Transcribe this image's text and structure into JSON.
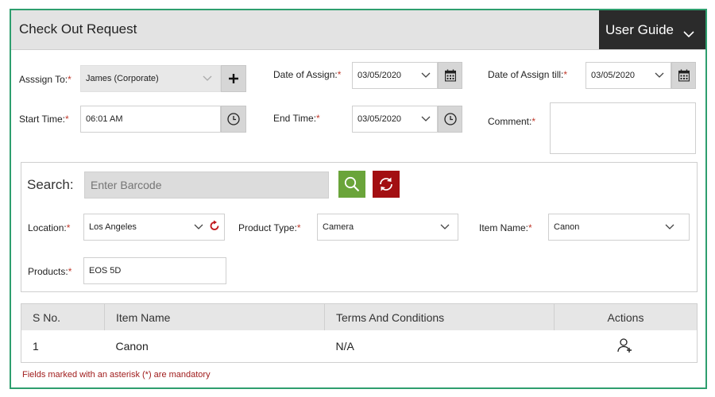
{
  "header": {
    "title": "Check Out Request",
    "user_guide_label": "User Guide"
  },
  "form": {
    "assign_to": {
      "label": "Asssign To:",
      "required_mark": "*",
      "value": "James (Corporate)"
    },
    "date_of_assign": {
      "label": "Date of Assign:",
      "required_mark": "*",
      "value": "03/05/2020"
    },
    "date_of_assign_till": {
      "label": "Date of Assign till:",
      "required_mark": "*",
      "value": "03/05/2020"
    },
    "start_time": {
      "label": "Start Time:",
      "required_mark": "*",
      "value": "06:01 AM"
    },
    "end_time": {
      "label": "End Time:",
      "required_mark": "*",
      "value": "03/05/2020"
    },
    "comment": {
      "label": "Comment:",
      "required_mark": "*",
      "value": ""
    }
  },
  "search": {
    "label": "Search:",
    "barcode_placeholder": "Enter Barcode",
    "location": {
      "label": "Location:",
      "required_mark": "*",
      "value": "Los Angeles"
    },
    "product_type": {
      "label": "Product Type:",
      "required_mark": "*",
      "value": "Camera"
    },
    "item_name": {
      "label": "Item Name:",
      "required_mark": "*",
      "value": "Canon"
    },
    "products": {
      "label": "Products:",
      "required_mark": "*",
      "value": "EOS 5D"
    }
  },
  "table": {
    "headers": [
      "S No.",
      "Item Name",
      "Terms And Conditions",
      "Actions"
    ],
    "rows": [
      {
        "sno": "1",
        "item_name": "Canon",
        "terms": "N/A",
        "action_icon": "add-user-icon"
      }
    ]
  },
  "footnote": "Fields marked with an asterisk (*) are mandatory",
  "colors": {
    "frame_border": "#2e9e6e",
    "search_button": "#6aa43a",
    "reset_button": "#a30f12",
    "required": "#c0392b",
    "guide_button": "#2b2b2b"
  }
}
